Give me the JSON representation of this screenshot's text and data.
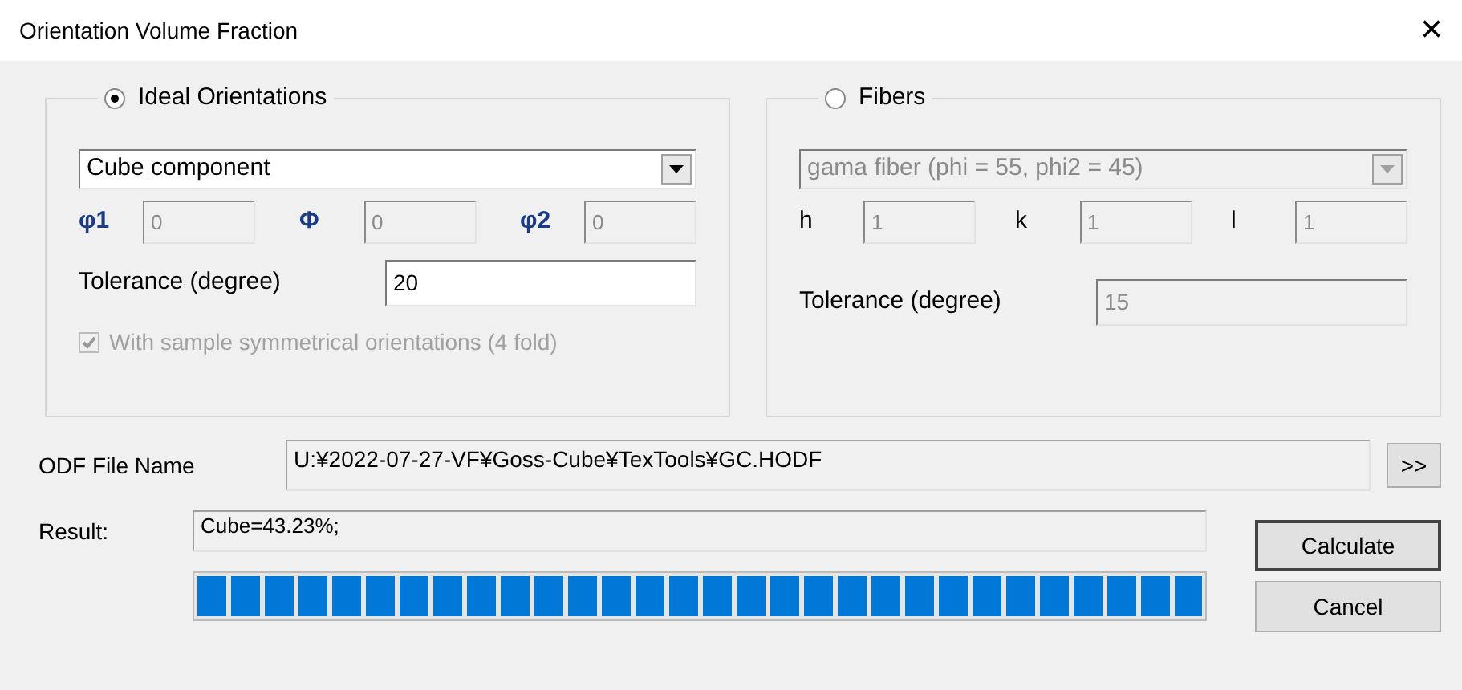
{
  "window": {
    "title": "Orientation Volume Fraction",
    "close": "×"
  },
  "groups": [
    {
      "label": "Ideal Orientations",
      "selected": true,
      "disabled": false,
      "dropdown": "Cube component",
      "fields": [
        {
          "label": "φ1",
          "value": "0"
        },
        {
          "label": "Φ",
          "value": "0"
        },
        {
          "label": "φ2",
          "value": "0"
        }
      ],
      "tolerance": {
        "label": "Tolerance (degree)",
        "value": "20"
      },
      "checkbox": {
        "label": "With sample symmetrical orientations (4 fold)",
        "checked": true,
        "disabled": true
      }
    },
    {
      "label": "Fibers",
      "selected": false,
      "disabled": true,
      "dropdown": "gama fiber (phi = 55, phi2 = 45)",
      "fields": [
        {
          "label": "h",
          "value": "1"
        },
        {
          "label": "k",
          "value": "1"
        },
        {
          "label": "l",
          "value": "1"
        }
      ],
      "tolerance": {
        "label": "Tolerance (degree)",
        "value": "15"
      }
    }
  ],
  "odf": {
    "label": "ODF File Name",
    "value": "U:¥2022-07-27-VF¥Goss-Cube¥TexTools¥GC.HODF",
    "browse": ">>"
  },
  "result": {
    "label": "Result:",
    "value": "Cube=43.23%;"
  },
  "progress": {
    "level": 1
  },
  "buttons": [
    "Calculate",
    "Cancel"
  ]
}
